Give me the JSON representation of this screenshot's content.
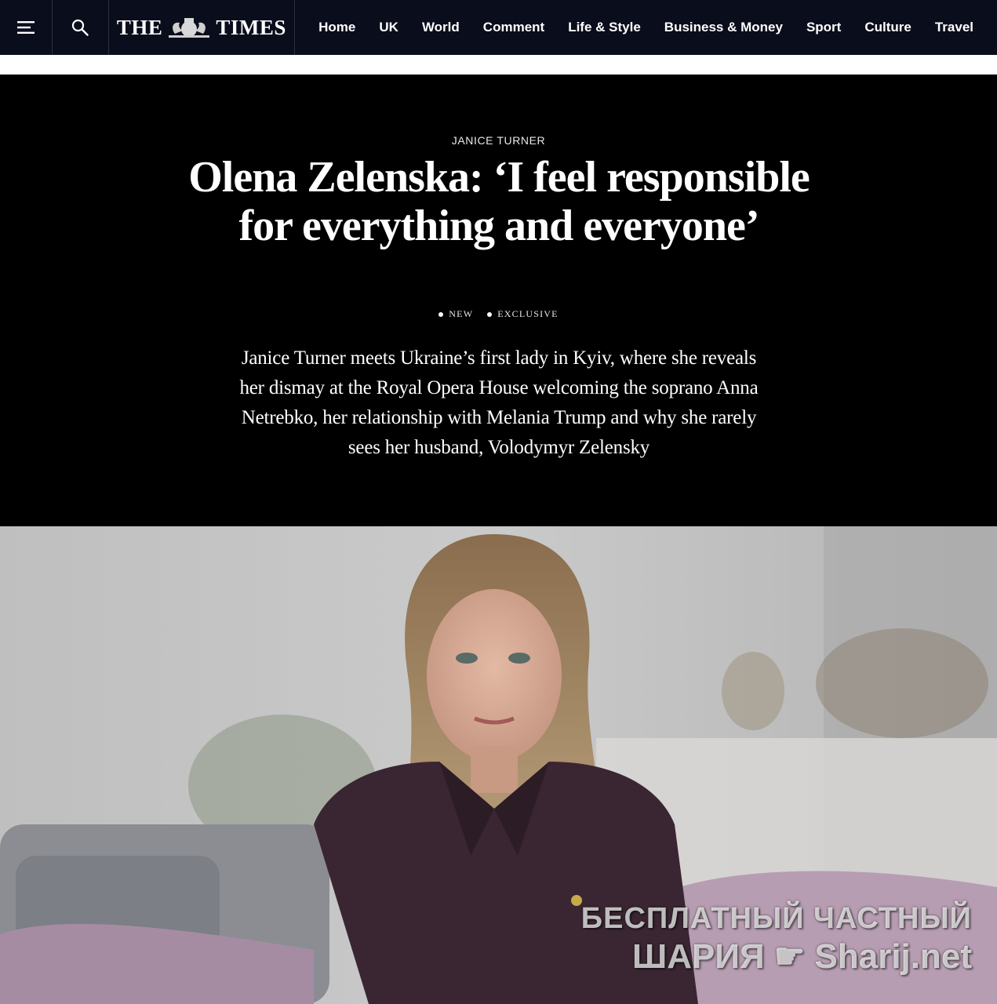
{
  "header": {
    "menu_icon": "hamburger-menu-icon",
    "search_icon": "search-icon",
    "logo_left": "THE",
    "logo_right": "TIMES",
    "nav": [
      {
        "label": "Home"
      },
      {
        "label": "UK"
      },
      {
        "label": "World"
      },
      {
        "label": "Comment"
      },
      {
        "label": "Life & Style"
      },
      {
        "label": "Business & Money"
      },
      {
        "label": "Sport"
      },
      {
        "label": "Culture"
      },
      {
        "label": "Travel"
      }
    ],
    "bg_color": "#0a0d1c"
  },
  "article": {
    "author": "JANICE TURNER",
    "headline": "Olena Zelenska: ‘I feel responsible for everything and everyone’",
    "tags": [
      "NEW",
      "EXCLUSIVE"
    ],
    "standfirst": "Janice Turner meets Ukraine’s first lady in Kyiv, where she reveals her dismay at the Royal Opera House welcoming the soprano Anna Netrebko, her relationship with Melania Trump and why she rarely sees her husband, Volodymyr Zelensky",
    "hero_bg": "#000000"
  },
  "photo": {
    "watermark_line1": "БЕСПЛАТНЫЙ ЧАСТНЫЙ",
    "watermark_line2_left": "ШАРИЯ",
    "watermark_icon": "pointing-hand-icon",
    "watermark_line2_right": "Sharij.net"
  }
}
